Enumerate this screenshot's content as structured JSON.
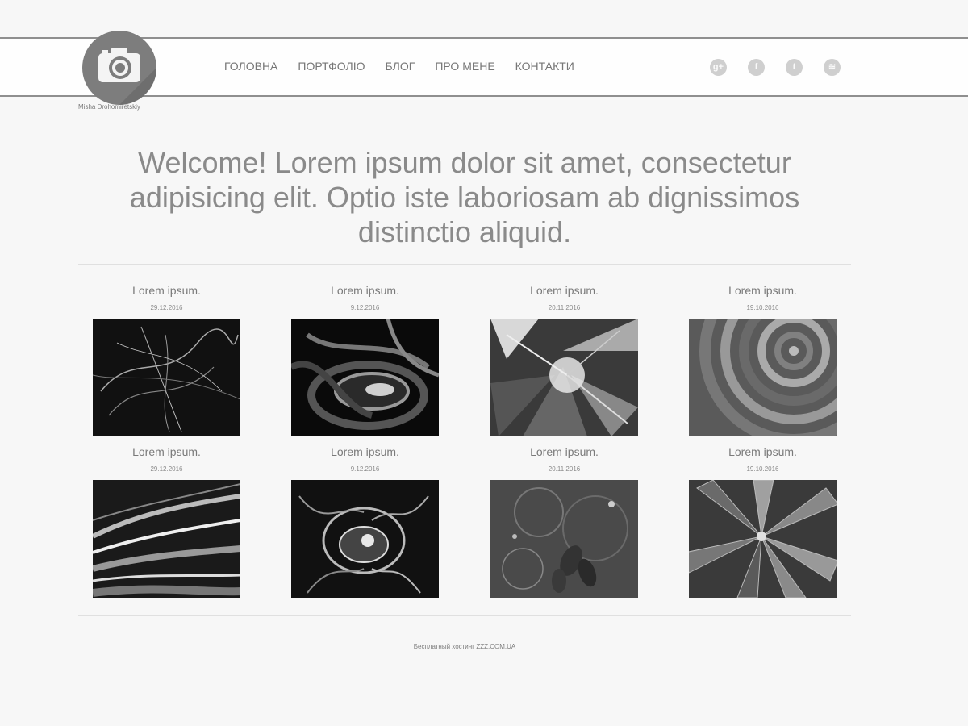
{
  "brand": {
    "caption": "Misha Drohomiretskiy",
    "logo_icon": "camera-icon"
  },
  "nav": {
    "items": [
      "ГОЛОВНА",
      "ПОРТФОЛІО",
      "БЛОГ",
      "ПРО МЕНЕ",
      "КОНТАКТИ"
    ]
  },
  "social": {
    "items": [
      {
        "icon": "google-plus-icon",
        "glyph": "g+"
      },
      {
        "icon": "facebook-icon",
        "glyph": "f"
      },
      {
        "icon": "twitter-icon",
        "glyph": "t"
      },
      {
        "icon": "rss-icon",
        "glyph": "≋"
      }
    ]
  },
  "hero": {
    "text": "Welcome! Lorem ipsum dolor sit amet, consectetur adipisicing elit. Optio iste laboriosam ab dignissimos distinctio aliquid."
  },
  "gallery": {
    "cards": [
      {
        "title": "Lorem ipsum.",
        "date": "29.12.2016",
        "image": "abstract-fractal-1"
      },
      {
        "title": "Lorem ipsum.",
        "date": "9.12.2016",
        "image": "abstract-fractal-2"
      },
      {
        "title": "Lorem ipsum.",
        "date": "20.11.2016",
        "image": "abstract-fractal-3"
      },
      {
        "title": "Lorem ipsum.",
        "date": "19.10.2016",
        "image": "abstract-fractal-4"
      },
      {
        "title": "Lorem ipsum.",
        "date": "29.12.2016",
        "image": "abstract-fractal-5"
      },
      {
        "title": "Lorem ipsum.",
        "date": "9.12.2016",
        "image": "abstract-fractal-6"
      },
      {
        "title": "Lorem ipsum.",
        "date": "20.11.2016",
        "image": "abstract-fractal-7"
      },
      {
        "title": "Lorem ipsum.",
        "date": "19.10.2016",
        "image": "abstract-fractal-8"
      }
    ]
  },
  "footer": {
    "text": "Бесплатный хостинг ZZZ.COM.UA"
  },
  "colors": {
    "background": "#f7f7f7",
    "header_border": "#8f8f8f",
    "logo_circle": "#7d7d7d",
    "social_icon": "#cfcfcf",
    "text": "#8a8a8a"
  }
}
